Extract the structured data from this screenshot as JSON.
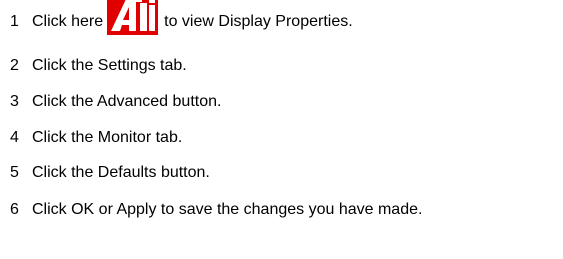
{
  "steps": [
    {
      "number": "1",
      "prefix": "Click here",
      "link_logo": "ati-logo",
      "suffix": "to view Display Properties."
    },
    {
      "number": "2",
      "text": "Click the Settings tab."
    },
    {
      "number": "3",
      "text": "Click the Advanced button."
    },
    {
      "number": "4",
      "text": "Click the Monitor tab."
    },
    {
      "number": "5",
      "text": "Click the Defaults button."
    },
    {
      "number": "6",
      "text": "Click OK or Apply to save the changes you have made."
    }
  ],
  "logo": {
    "background_color": "#e00000",
    "text_color": "#ffffff",
    "icon": "ati-logo-icon"
  }
}
